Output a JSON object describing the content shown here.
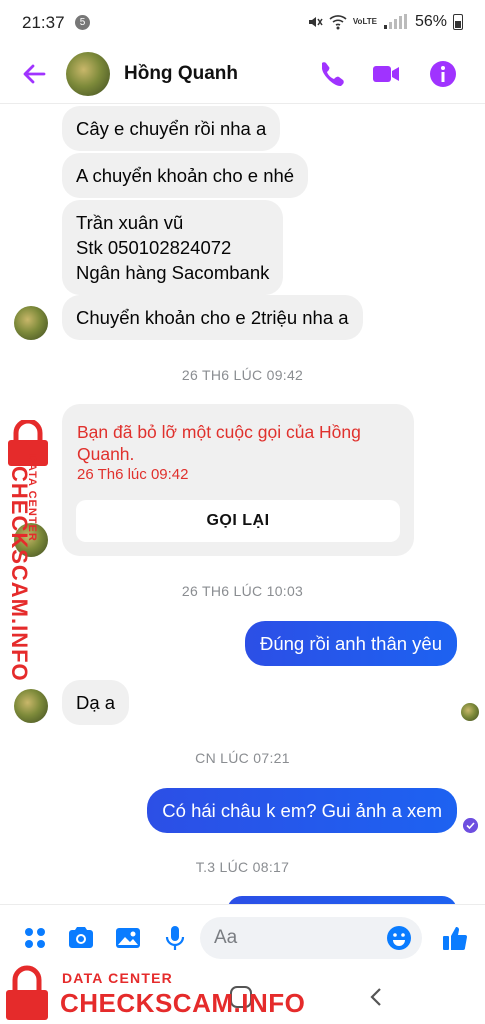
{
  "status_bar": {
    "time": "21:37",
    "notification_count": "5",
    "battery": "56%"
  },
  "header": {
    "contact_name": "Hồng Quanh",
    "accent_color": "#a033ff"
  },
  "messages": {
    "m1": "Cây e chuyển rồi nha a",
    "m2": "A chuyển khoản cho e nhé",
    "m3": "Trần xuân vũ\nStk 050102824072\nNgân hàng Sacombank",
    "m4": "Chuyển khoản cho e 2triệu nha a",
    "m5": "Đúng rồi anh thân yêu",
    "m6": "Dạ a",
    "m7": "Có hái châu k em? Gui ảnh a xem"
  },
  "timestamps": {
    "t1": "26 TH6 LÚC 09:42",
    "t2": "26 TH6 LÚC 10:03",
    "t3": "CN LÚC 07:21",
    "t4": "T.3 LÚC 08:17"
  },
  "missed_call": {
    "text": "Bạn đã bỏ lỡ một cuộc gọi của Hồng Quanh.",
    "time": "26 Th6 lúc 09:42",
    "callback_label": "GỌI LẠI"
  },
  "composer": {
    "placeholder": "Aa"
  },
  "watermark": {
    "data_center": "DATA CENTER",
    "brand": "CHECKSCAM.INFO"
  },
  "colors": {
    "outgoing_bubble": "#1e5cf0",
    "incoming_bubble": "#f0f0f0",
    "missed_call_text": "#e0312d",
    "icon_blue": "#0a7cff",
    "watermark_red": "#e52b2b"
  }
}
